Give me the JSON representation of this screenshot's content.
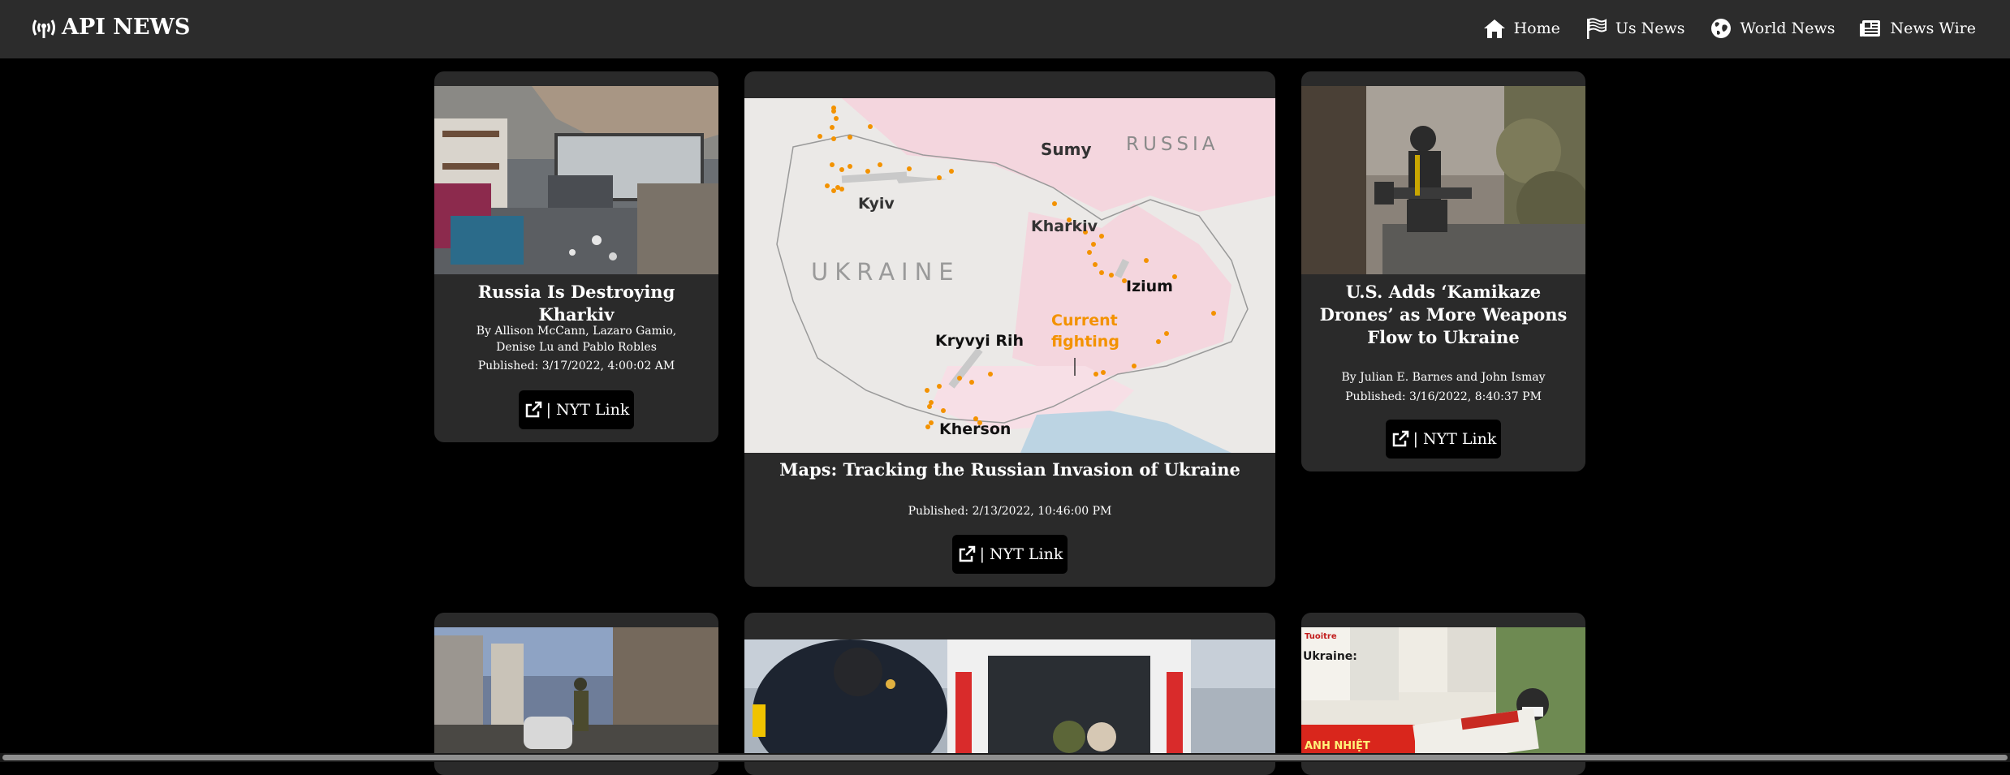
{
  "nav": {
    "brand": "API NEWS",
    "links": [
      {
        "label": "Home",
        "icon": "home-icon"
      },
      {
        "label": "Us News",
        "icon": "flag-icon"
      },
      {
        "label": "World News",
        "icon": "globe-icon"
      },
      {
        "label": "News Wire",
        "icon": "newspaper-icon"
      }
    ]
  },
  "cards": [
    {
      "title": "Russia Is Destroying Kharkiv",
      "byline": "By Allison McCann, Lazaro Gamio, Denise Lu and Pablo Robles",
      "published": "Published: 3/17/2022, 4:00:02 AM",
      "link_label": "| NYT Link"
    },
    {
      "title": "Maps: Tracking the Russian Invasion of Ukraine",
      "byline": "",
      "published": "Published: 2/13/2022, 10:46:00 PM",
      "link_label": "| NYT Link",
      "map_labels": {
        "country1": "RUSSIA",
        "country2": "UKRAINE",
        "cities": [
          "Sumy",
          "Kyiv",
          "Kharkiv",
          "Izium",
          "Kryvyi Rih",
          "Kherson"
        ],
        "fighting": "Current fighting"
      }
    },
    {
      "title": "U.S. Adds ‘Kamikaze Drones’ as More Weapons Flow to Ukraine",
      "byline": "By Julian E. Barnes and John Ismay",
      "published": "Published: 3/16/2022, 8:40:37 PM",
      "link_label": "| NYT Link"
    }
  ],
  "second_row": [
    {
      "image": "kyiv-street-soldier-photo"
    },
    {
      "image": "ambulance-photo"
    },
    {
      "image": "newspaper-stand-photo",
      "visible_text": [
        "Ukraine:",
        "ANH NHIỆT",
        "Tuoitre"
      ]
    }
  ],
  "colors": {
    "navbar": "#2c2c2c",
    "card": "#2a2a2a",
    "accent": "#f5a623",
    "background": "#000000"
  }
}
